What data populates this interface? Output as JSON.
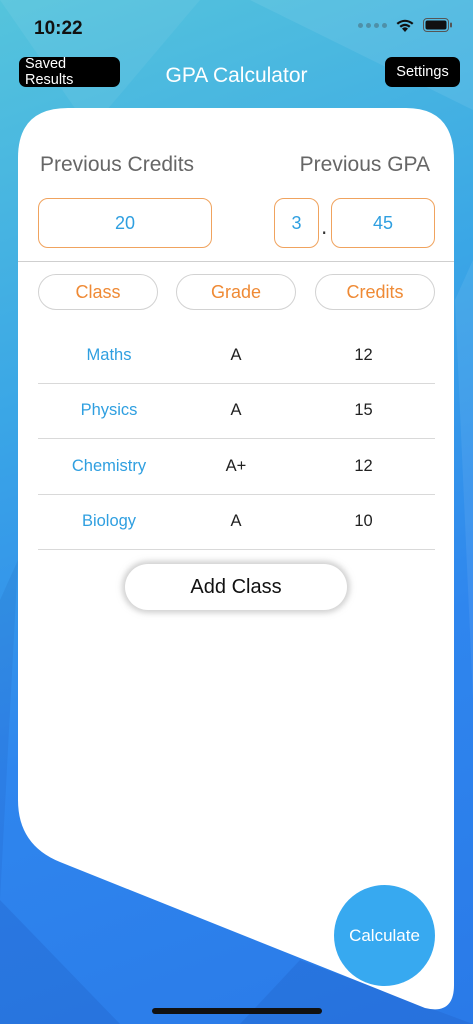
{
  "status_bar": {
    "time": "10:22"
  },
  "nav": {
    "saved_results": "Saved Results",
    "title": "GPA Calculator",
    "settings": "Settings"
  },
  "previous": {
    "credits_label": "Previous Credits",
    "gpa_label": "Previous GPA",
    "credits_value": "20",
    "gpa_integer": "3",
    "gpa_separator": ".",
    "gpa_decimal": "45"
  },
  "columns": {
    "class": "Class",
    "grade": "Grade",
    "credits": "Credits"
  },
  "rows": [
    {
      "class": "Maths",
      "grade": "A",
      "credits": "12"
    },
    {
      "class": "Physics",
      "grade": "A",
      "credits": "15"
    },
    {
      "class": "Chemistry",
      "grade": "A+",
      "credits": "12"
    },
    {
      "class": "Biology",
      "grade": "A",
      "credits": "10"
    }
  ],
  "actions": {
    "add_class": "Add Class",
    "calculate": "Calculate"
  },
  "colors": {
    "accent_blue": "#2f9fe0",
    "accent_orange": "#ef8a35",
    "calculate_bg": "#37a9f0"
  }
}
